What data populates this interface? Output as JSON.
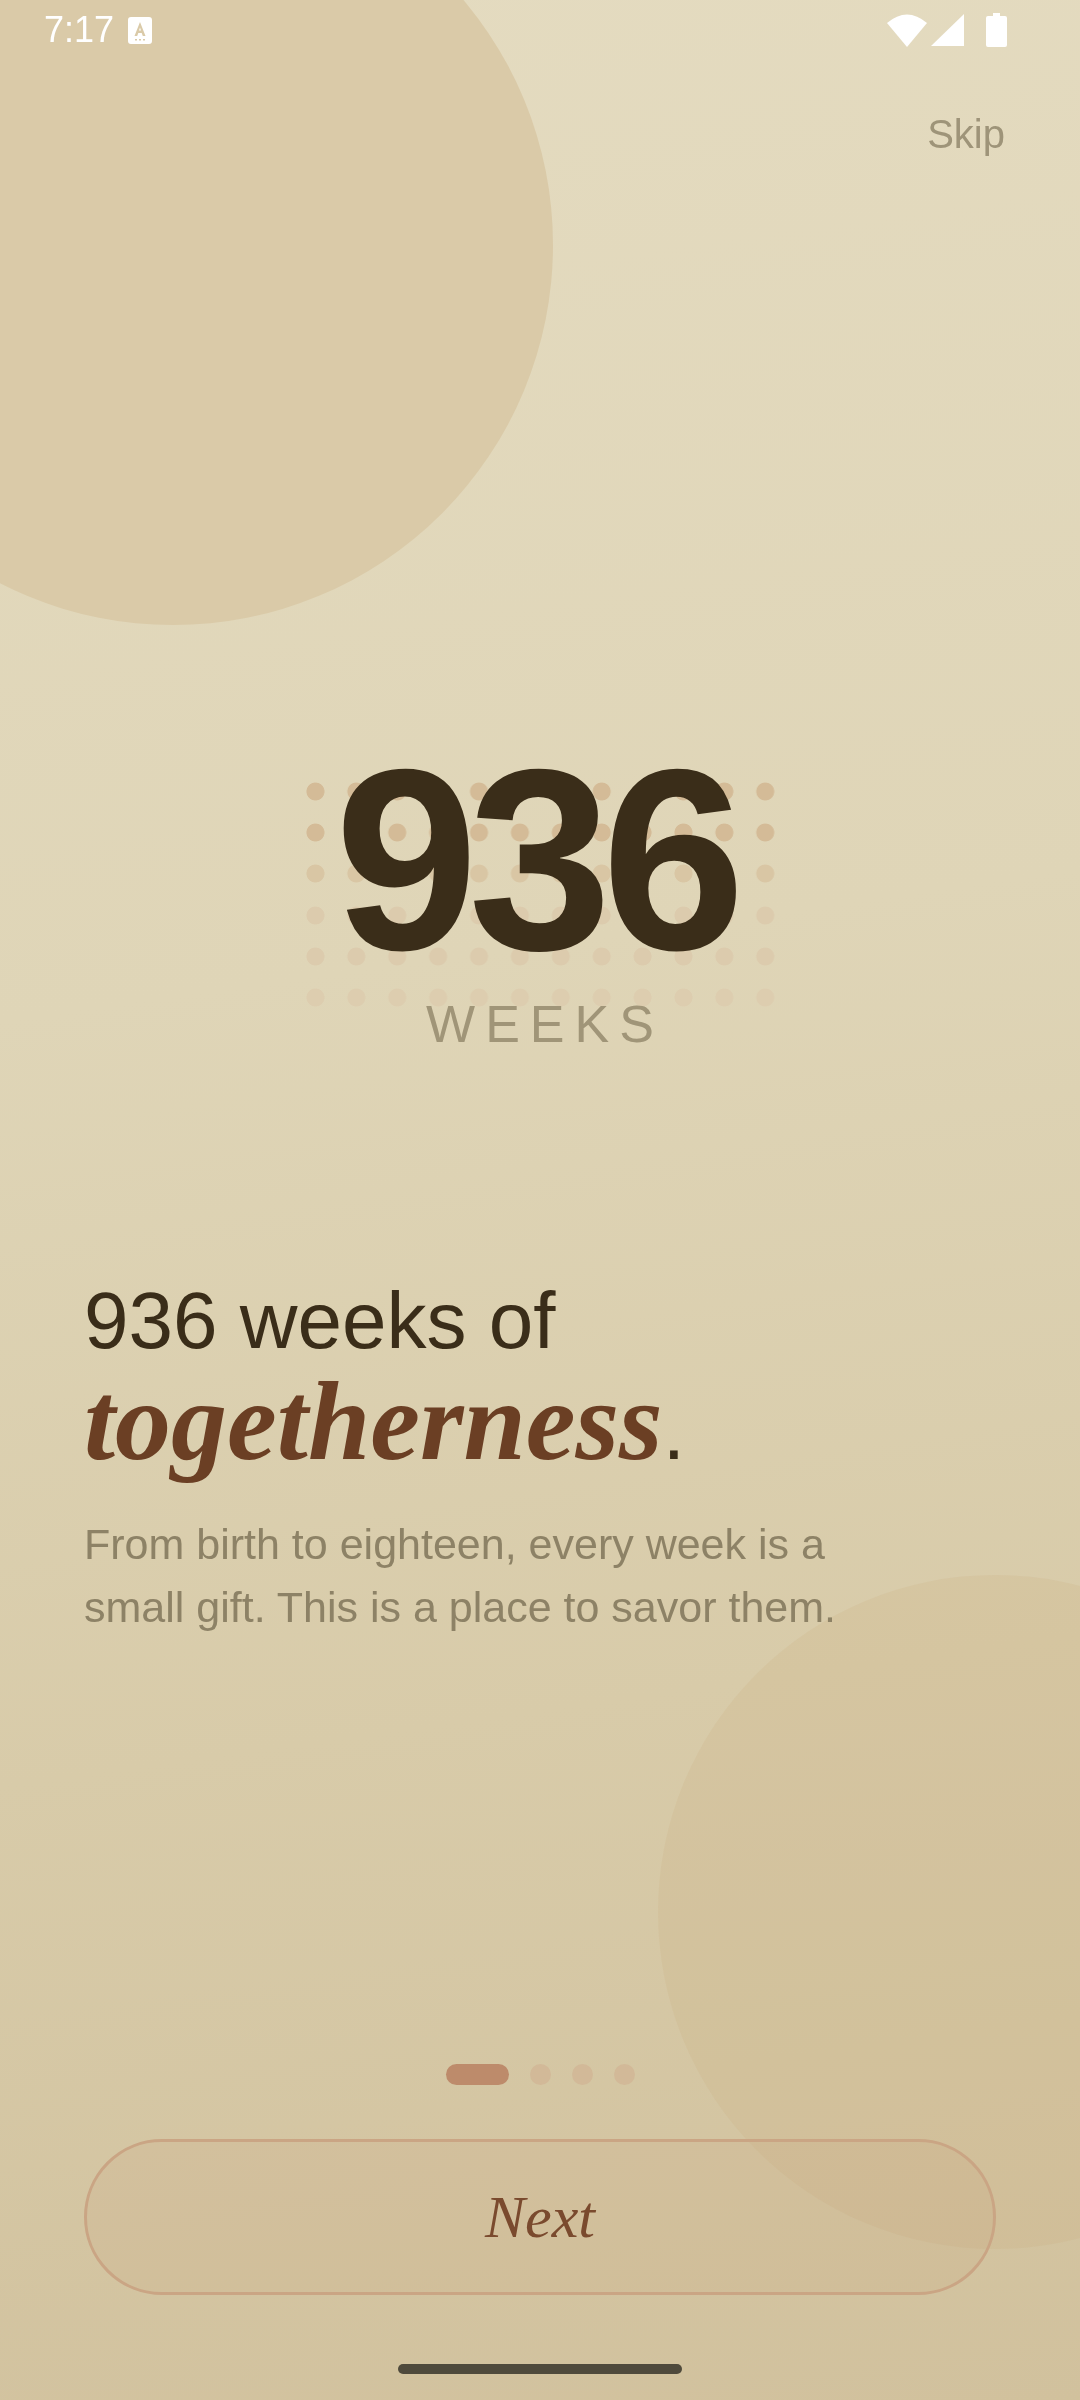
{
  "status_bar": {
    "time": "7:17"
  },
  "skip": {
    "label": "Skip"
  },
  "hero": {
    "count": "936",
    "unit": "WEEKS"
  },
  "headline": "936 weeks of *togetherness*.",
  "body": "From birth to eighteen, every week is a small gift. This is a place to savor them.",
  "pager": [
    {
      "selected": true
    },
    {
      "selected": false
    },
    {
      "selected": false
    },
    {
      "selected": false
    }
  ],
  "next_button": {
    "label": "Next"
  }
}
